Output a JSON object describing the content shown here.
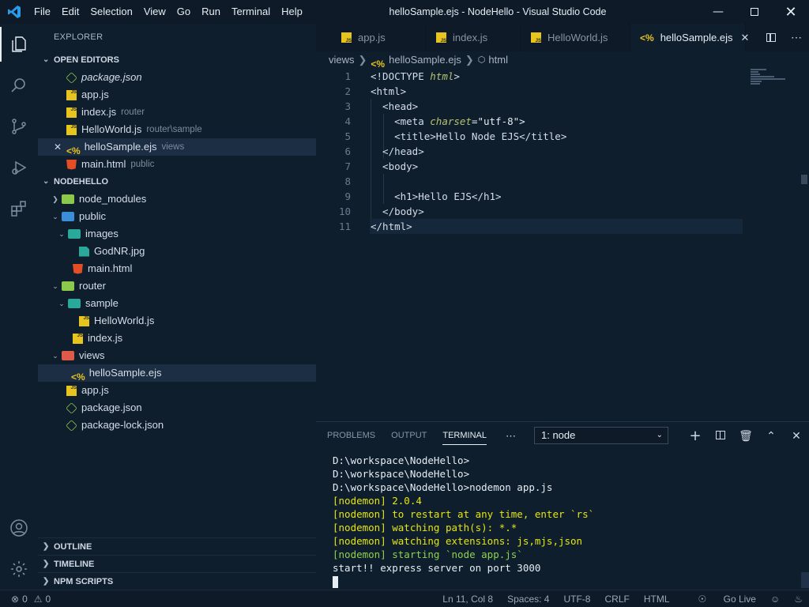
{
  "window": {
    "title": "helloSample.ejs - NodeHello - Visual Studio Code",
    "menu": [
      "File",
      "Edit",
      "Selection",
      "View",
      "Go",
      "Run",
      "Terminal",
      "Help"
    ]
  },
  "sidebar": {
    "title": "EXPLORER",
    "open_editors_label": "OPEN EDITORS",
    "open_editors": [
      {
        "name": "package.json",
        "desc": ""
      },
      {
        "name": "app.js",
        "desc": ""
      },
      {
        "name": "index.js",
        "desc": "router"
      },
      {
        "name": "HelloWorld.js",
        "desc": "router\\sample"
      },
      {
        "name": "helloSample.ejs",
        "desc": "views"
      },
      {
        "name": "main.html",
        "desc": "public"
      }
    ],
    "project_label": "NODEHELLO",
    "tree": [
      "node_modules",
      "public",
      "images",
      "GodNR.jpg",
      "main.html",
      "router",
      "sample",
      "HelloWorld.js",
      "index.js",
      "views",
      "helloSample.ejs",
      "app.js",
      "package.json",
      "package-lock.json"
    ],
    "outline_label": "OUTLINE",
    "timeline_label": "TIMELINE",
    "npm_label": "NPM SCRIPTS"
  },
  "tabs": [
    "app.js",
    "index.js",
    "HelloWorld.js",
    "helloSample.ejs"
  ],
  "breadcrumb": {
    "folder": "views",
    "file": "helloSample.ejs",
    "symbol": "html"
  },
  "editor": {
    "line_numbers": [
      "1",
      "2",
      "3",
      "4",
      "5",
      "6",
      "7",
      "8",
      "9",
      "10",
      "11"
    ],
    "l1_a": "<!DOCTYPE ",
    "l1_b": "html",
    "l1_c": ">",
    "l2": "<html>",
    "l3": "  <head>",
    "l4_a": "    <meta ",
    "l4_b": "charset",
    "l4_c": "=\"utf-8\">",
    "l5": "    <title>Hello Node EJS</title>",
    "l6": "  </head>",
    "l7": "  <body>",
    "l8": "",
    "l9": "    <h1>Hello EJS</h1>",
    "l10": "  </body>",
    "l11": "</html>"
  },
  "panel": {
    "tabs": [
      "PROBLEMS",
      "OUTPUT",
      "TERMINAL"
    ],
    "terminal_select": "1: node",
    "lines": [
      "D:\\workspace\\NodeHello>",
      "D:\\workspace\\NodeHello>",
      "D:\\workspace\\NodeHello>nodemon app.js",
      "[nodemon] 2.0.4",
      "[nodemon] to restart at any time, enter `rs`",
      "[nodemon] watching path(s): *.*",
      "[nodemon] watching extensions: js,mjs,json",
      "[nodemon] starting `node app.js`",
      "start!! express server on port 3000"
    ]
  },
  "status": {
    "errors": "0",
    "warnings": "0",
    "position": "Ln 11, Col 8",
    "spaces": "Spaces: 4",
    "encoding": "UTF-8",
    "eol": "CRLF",
    "language": "HTML",
    "golive": "Go Live"
  },
  "colors": {
    "accent_js": "#e8c51e",
    "node_green": "#8cc84b",
    "html_orange": "#e44d26",
    "bg": "#0f1e2d"
  }
}
